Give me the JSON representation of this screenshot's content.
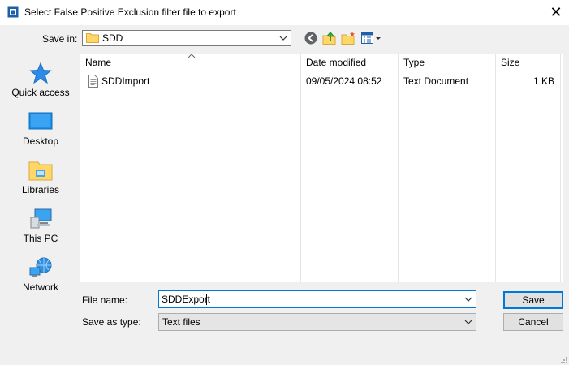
{
  "window": {
    "title": "Select False Positive Exclusion filter file to export",
    "app_icon": "app-window-icon",
    "close_glyph": "✕"
  },
  "toolbar": {
    "save_in_label": "Save in:",
    "save_in_value": "SDD",
    "icons": [
      "back-icon",
      "up-folder-icon",
      "new-folder-icon",
      "view-menu-icon"
    ]
  },
  "places": [
    {
      "label": "Quick access",
      "icon": "quick-access-star-icon"
    },
    {
      "label": "Desktop",
      "icon": "desktop-icon"
    },
    {
      "label": "Libraries",
      "icon": "libraries-icon"
    },
    {
      "label": "This PC",
      "icon": "this-pc-icon"
    },
    {
      "label": "Network",
      "icon": "network-icon"
    }
  ],
  "file_list": {
    "columns": [
      "Name",
      "Date modified",
      "Type",
      "Size"
    ],
    "sort_indicator": "^",
    "rows": [
      {
        "name": "SDDImport",
        "date_modified": "09/05/2024 08:52",
        "type": "Text Document",
        "size": "1 KB"
      }
    ]
  },
  "form": {
    "file_name_label": "File name:",
    "file_name_value": "SDDExport",
    "save_as_type_label": "Save as type:",
    "save_as_type_value": "Text files"
  },
  "buttons": {
    "save": "Save",
    "cancel": "Cancel"
  },
  "colors": {
    "accent": "#0078d7",
    "window_bg": "#f0f0f0",
    "list_bg": "#ffffff"
  }
}
